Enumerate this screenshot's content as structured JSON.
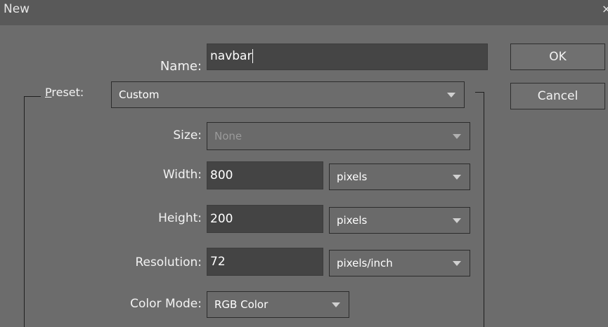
{
  "window": {
    "title": "New",
    "close_glyph": "×"
  },
  "name_field": {
    "label": "Name:",
    "value": "navbar"
  },
  "preset": {
    "label": "Preset:",
    "value": "Custom"
  },
  "size": {
    "label": "Size:",
    "value": "None"
  },
  "width": {
    "label": "Width:",
    "value": "800",
    "unit": "pixels"
  },
  "height": {
    "label": "Height:",
    "value": "200",
    "unit": "pixels"
  },
  "resolution": {
    "label": "Resolution:",
    "value": "72",
    "unit": "pixels/inch"
  },
  "color_mode": {
    "label": "Color Mode:",
    "value": "RGB Color"
  },
  "buttons": {
    "ok": "OK",
    "cancel": "Cancel"
  }
}
